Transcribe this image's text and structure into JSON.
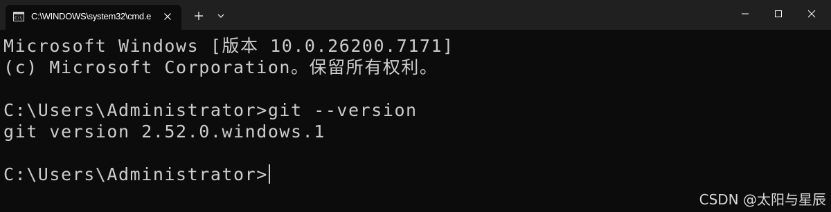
{
  "window": {
    "tab": {
      "title": "C:\\WINDOWS\\system32\\cmd.e",
      "icon": "cmd-icon"
    },
    "controls": {
      "new_tab_icon": "plus-icon",
      "dropdown_icon": "chevron-down-icon",
      "minimize_icon": "minimize-icon",
      "maximize_icon": "maximize-icon",
      "close_icon": "close-icon"
    }
  },
  "terminal": {
    "lines": [
      "Microsoft Windows [版本 10.0.26200.7171]",
      "(c) Microsoft Corporation。保留所有权利。",
      "C:\\Users\\Administrator>git --version",
      "git version 2.52.0.windows.1",
      "C:\\Users\\Administrator>"
    ],
    "foreground_color": "#cccccc",
    "background_color": "#0c0c0c"
  },
  "watermark": {
    "text": "CSDN @太阳与星辰"
  },
  "colors": {
    "titlebar": "#202020",
    "active_tab": "#0c0c0c"
  }
}
